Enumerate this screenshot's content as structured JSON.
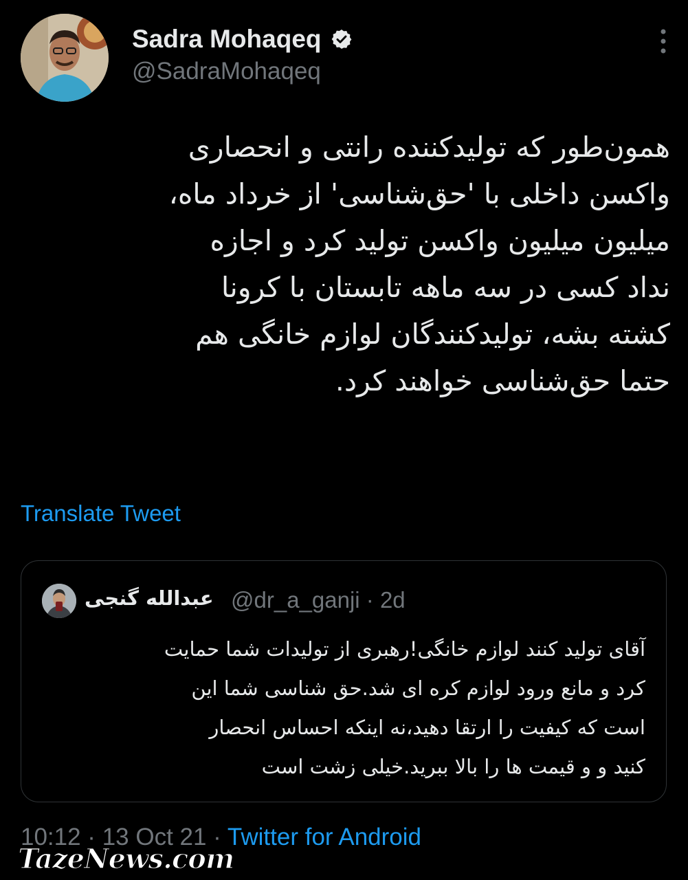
{
  "author": {
    "display_name": "Sadra Mohaqeq",
    "handle": "@SadraMohaqeq",
    "verified": true
  },
  "tweet": {
    "text": "همون‌طور که تولیدکننده رانتی و انحصاری\nواکسن داخلی با 'حق‌شناسی' از خرداد ماه،\nمیلیون میلیون واکسن تولید کرد و اجازه\nنداد کسی در سه ماهه تابستان با کرونا\nکشته بشه، تولیدکنندگان لوازم خانگی هم\nحتما حق‌شناسی خواهند کرد.",
    "translate_label": "Translate Tweet"
  },
  "quoted_tweet": {
    "display_name": "عبدالله گنجی",
    "handle_time": "@dr_a_ganji · 2d",
    "text": "آقای تولید کنند لوازم خانگی!رهبری از تولیدات شما حمایت\nکرد و مانع ورود لوازم کره ای شد.حق شناسی شما این\nاست که کیفیت را ارتقا دهید،نه اینکه احساس انحصار\nکنید و و قیمت ها را بالا ببرید.خیلی زشت است"
  },
  "meta": {
    "time_date": "10:12 · 13 Oct 21 · ",
    "source": "Twitter for Android"
  },
  "watermark": {
    "text": "TazeNews.com"
  },
  "icons": {
    "verified": "verified-badge-icon",
    "more": "more-options-icon"
  },
  "colors": {
    "background": "#000000",
    "link": "#1d9bf0",
    "secondary_text": "#71767b",
    "primary_text": "#e7e9ea",
    "border": "#2f3336"
  }
}
